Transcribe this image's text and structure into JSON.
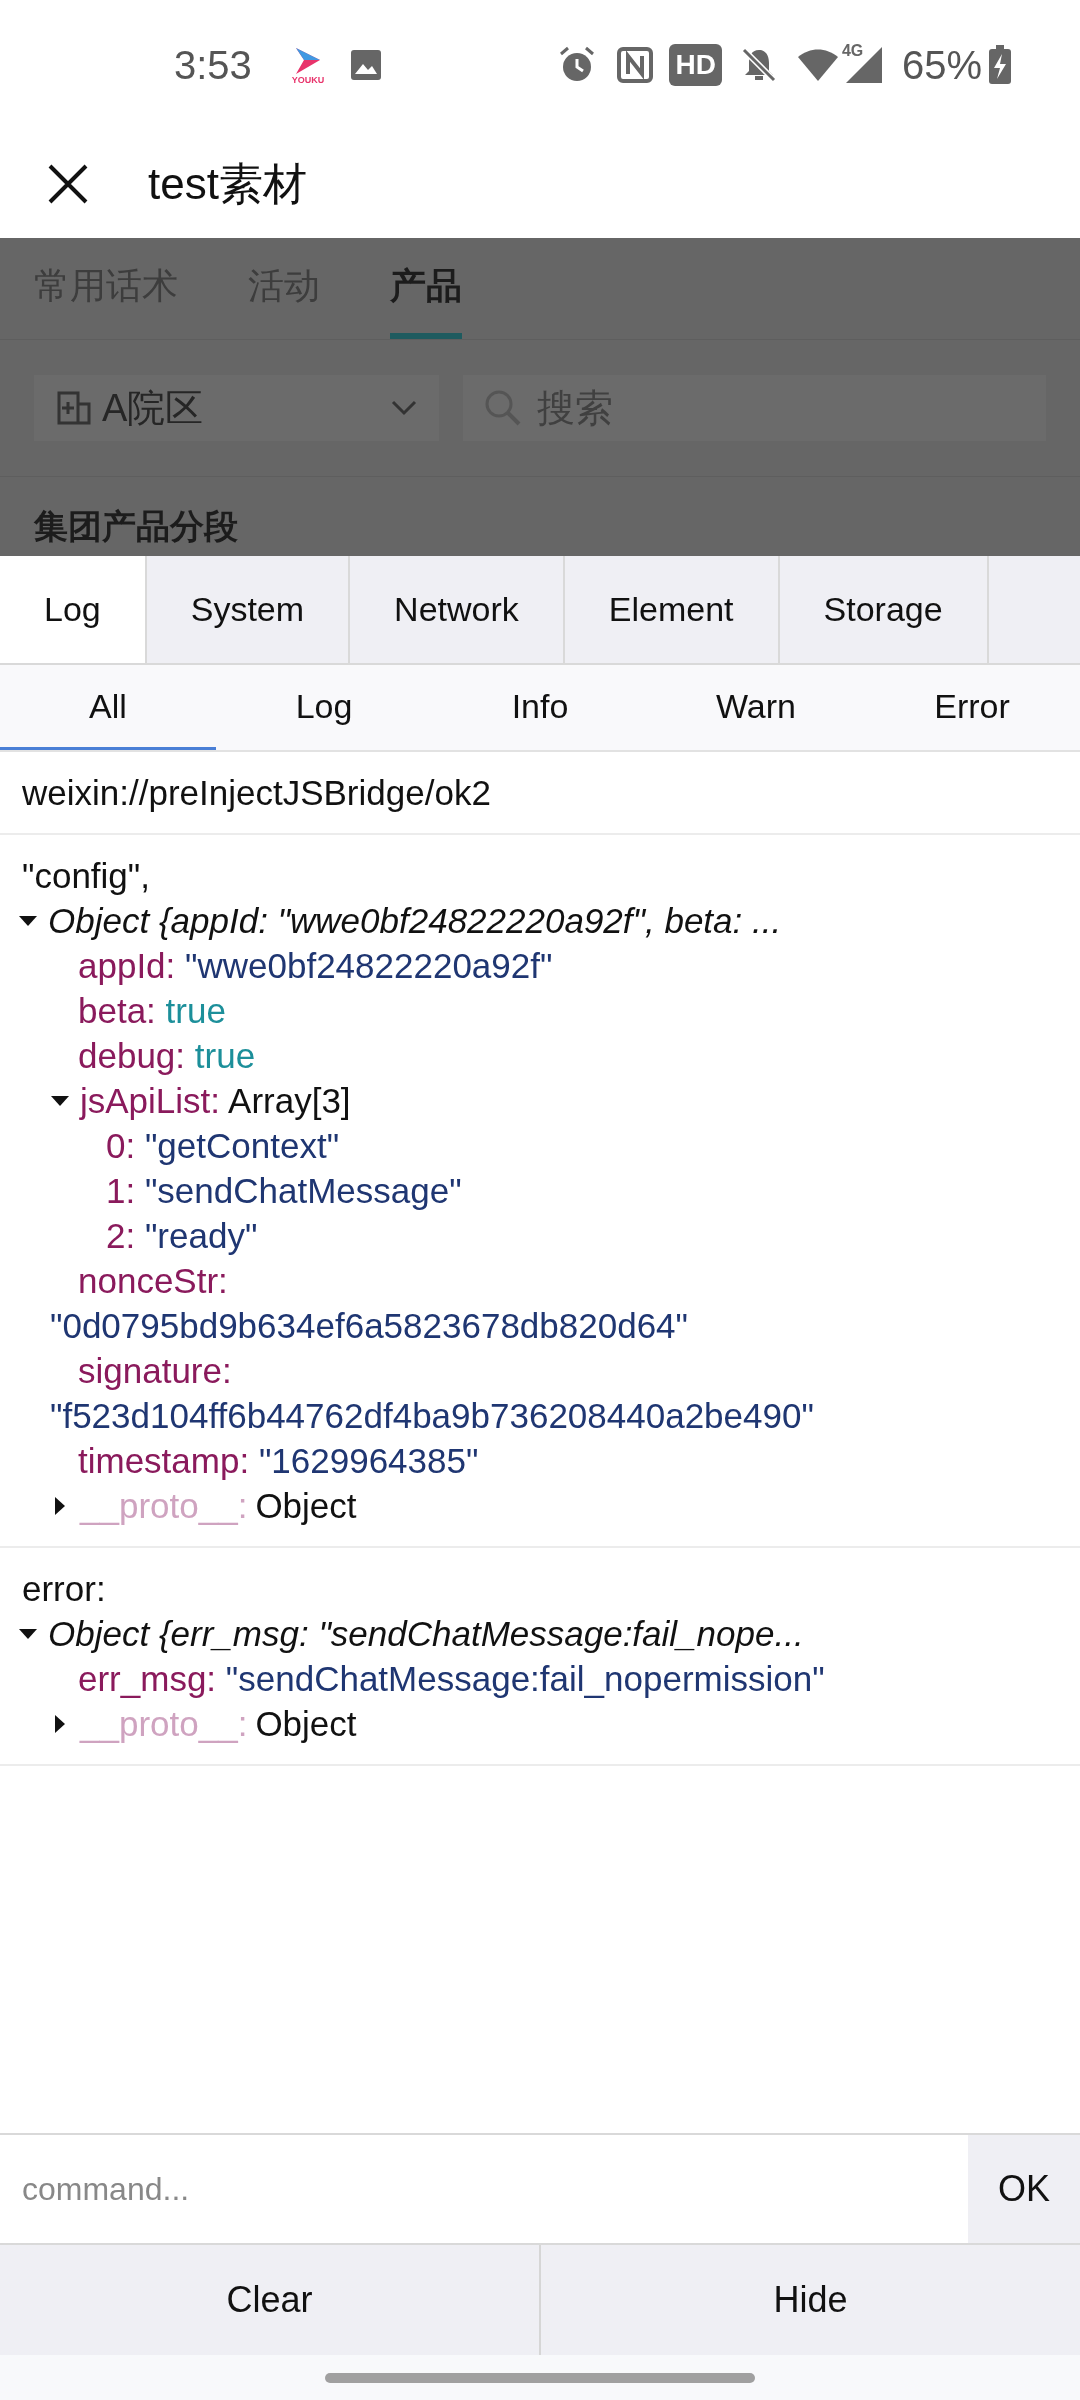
{
  "status_bar": {
    "time": "3:53",
    "app_label": "YOUKU",
    "network": "4G",
    "hd": "HD",
    "battery": "65%"
  },
  "header": {
    "title": "test素材"
  },
  "app_tabs": [
    {
      "label": "常用话术",
      "selected": false
    },
    {
      "label": "活动",
      "selected": false
    },
    {
      "label": "产品",
      "selected": true
    }
  ],
  "filters": {
    "campus": "A院区",
    "search_placeholder": "搜索"
  },
  "section_title": "集团产品分段",
  "console_tabs": [
    {
      "label": "Log",
      "selected": true
    },
    {
      "label": "System",
      "selected": false
    },
    {
      "label": "Network",
      "selected": false
    },
    {
      "label": "Element",
      "selected": false
    },
    {
      "label": "Storage",
      "selected": false
    }
  ],
  "level_tabs": [
    {
      "label": "All",
      "selected": true
    },
    {
      "label": "Log",
      "selected": false
    },
    {
      "label": "Info",
      "selected": false
    },
    {
      "label": "Warn",
      "selected": false
    },
    {
      "label": "Error",
      "selected": false
    }
  ],
  "entries": [
    {
      "lines": [
        {
          "kind": "text",
          "text": "weixin://preInjectJSBridge/ok2"
        }
      ]
    },
    {
      "lines": [
        {
          "kind": "text",
          "text": "\"config\","
        },
        {
          "kind": "summary",
          "text": "Object {appId: \"wwe0bf24822220a92f\", beta: ...",
          "expanded": true,
          "children": [
            {
              "kind": "prop",
              "key": "appId:",
              "value": "\"wwe0bf24822220a92f\"",
              "color": "#1f3672"
            },
            {
              "kind": "prop",
              "key": "beta:",
              "value": "true",
              "color": "#1c8f9a"
            },
            {
              "kind": "prop",
              "key": "debug:",
              "value": "true",
              "color": "#1c8f9a"
            },
            {
              "kind": "branch",
              "key": "jsApiList:",
              "value": "Array[3]",
              "expanded": true,
              "faded": false,
              "children": [
                {
                  "kind": "prop",
                  "key": "0:",
                  "value": "\"getContext\"",
                  "color": "#1f3672"
                },
                {
                  "kind": "prop",
                  "key": "1:",
                  "value": "\"sendChatMessage\"",
                  "color": "#1f3672"
                },
                {
                  "kind": "prop",
                  "key": "2:",
                  "value": "\"ready\"",
                  "color": "#1f3672"
                }
              ]
            },
            {
              "kind": "prop",
              "key": "nonceStr:",
              "value": "\"0d0795bd9b634ef6a5823678db820d64\"",
              "color": "#1f3672"
            },
            {
              "kind": "prop",
              "key": "signature:",
              "value": "\"f523d104ff6b44762df4ba9b736208440a2be490\"",
              "color": "#1f3672"
            },
            {
              "kind": "prop",
              "key": "timestamp:",
              "value": "\"1629964385\"",
              "color": "#1f3672"
            },
            {
              "kind": "branch",
              "key": "__proto__:",
              "value": "Object",
              "expanded": false,
              "faded": true
            }
          ]
        }
      ]
    },
    {
      "lines": [
        {
          "kind": "text",
          "text": "error:"
        },
        {
          "kind": "summary",
          "text": "Object {err_msg: \"sendChatMessage:fail_nope...",
          "expanded": true,
          "children": [
            {
              "kind": "prop",
              "key": "err_msg:",
              "value": "\"sendChatMessage:fail_nopermission\"",
              "color": "#1f3672"
            },
            {
              "kind": "branch",
              "key": "__proto__:",
              "value": "Object",
              "expanded": false,
              "faded": true
            }
          ]
        }
      ]
    }
  ],
  "command": {
    "placeholder": "command...",
    "submit": "OK"
  },
  "actions": [
    "Clear",
    "Hide"
  ]
}
